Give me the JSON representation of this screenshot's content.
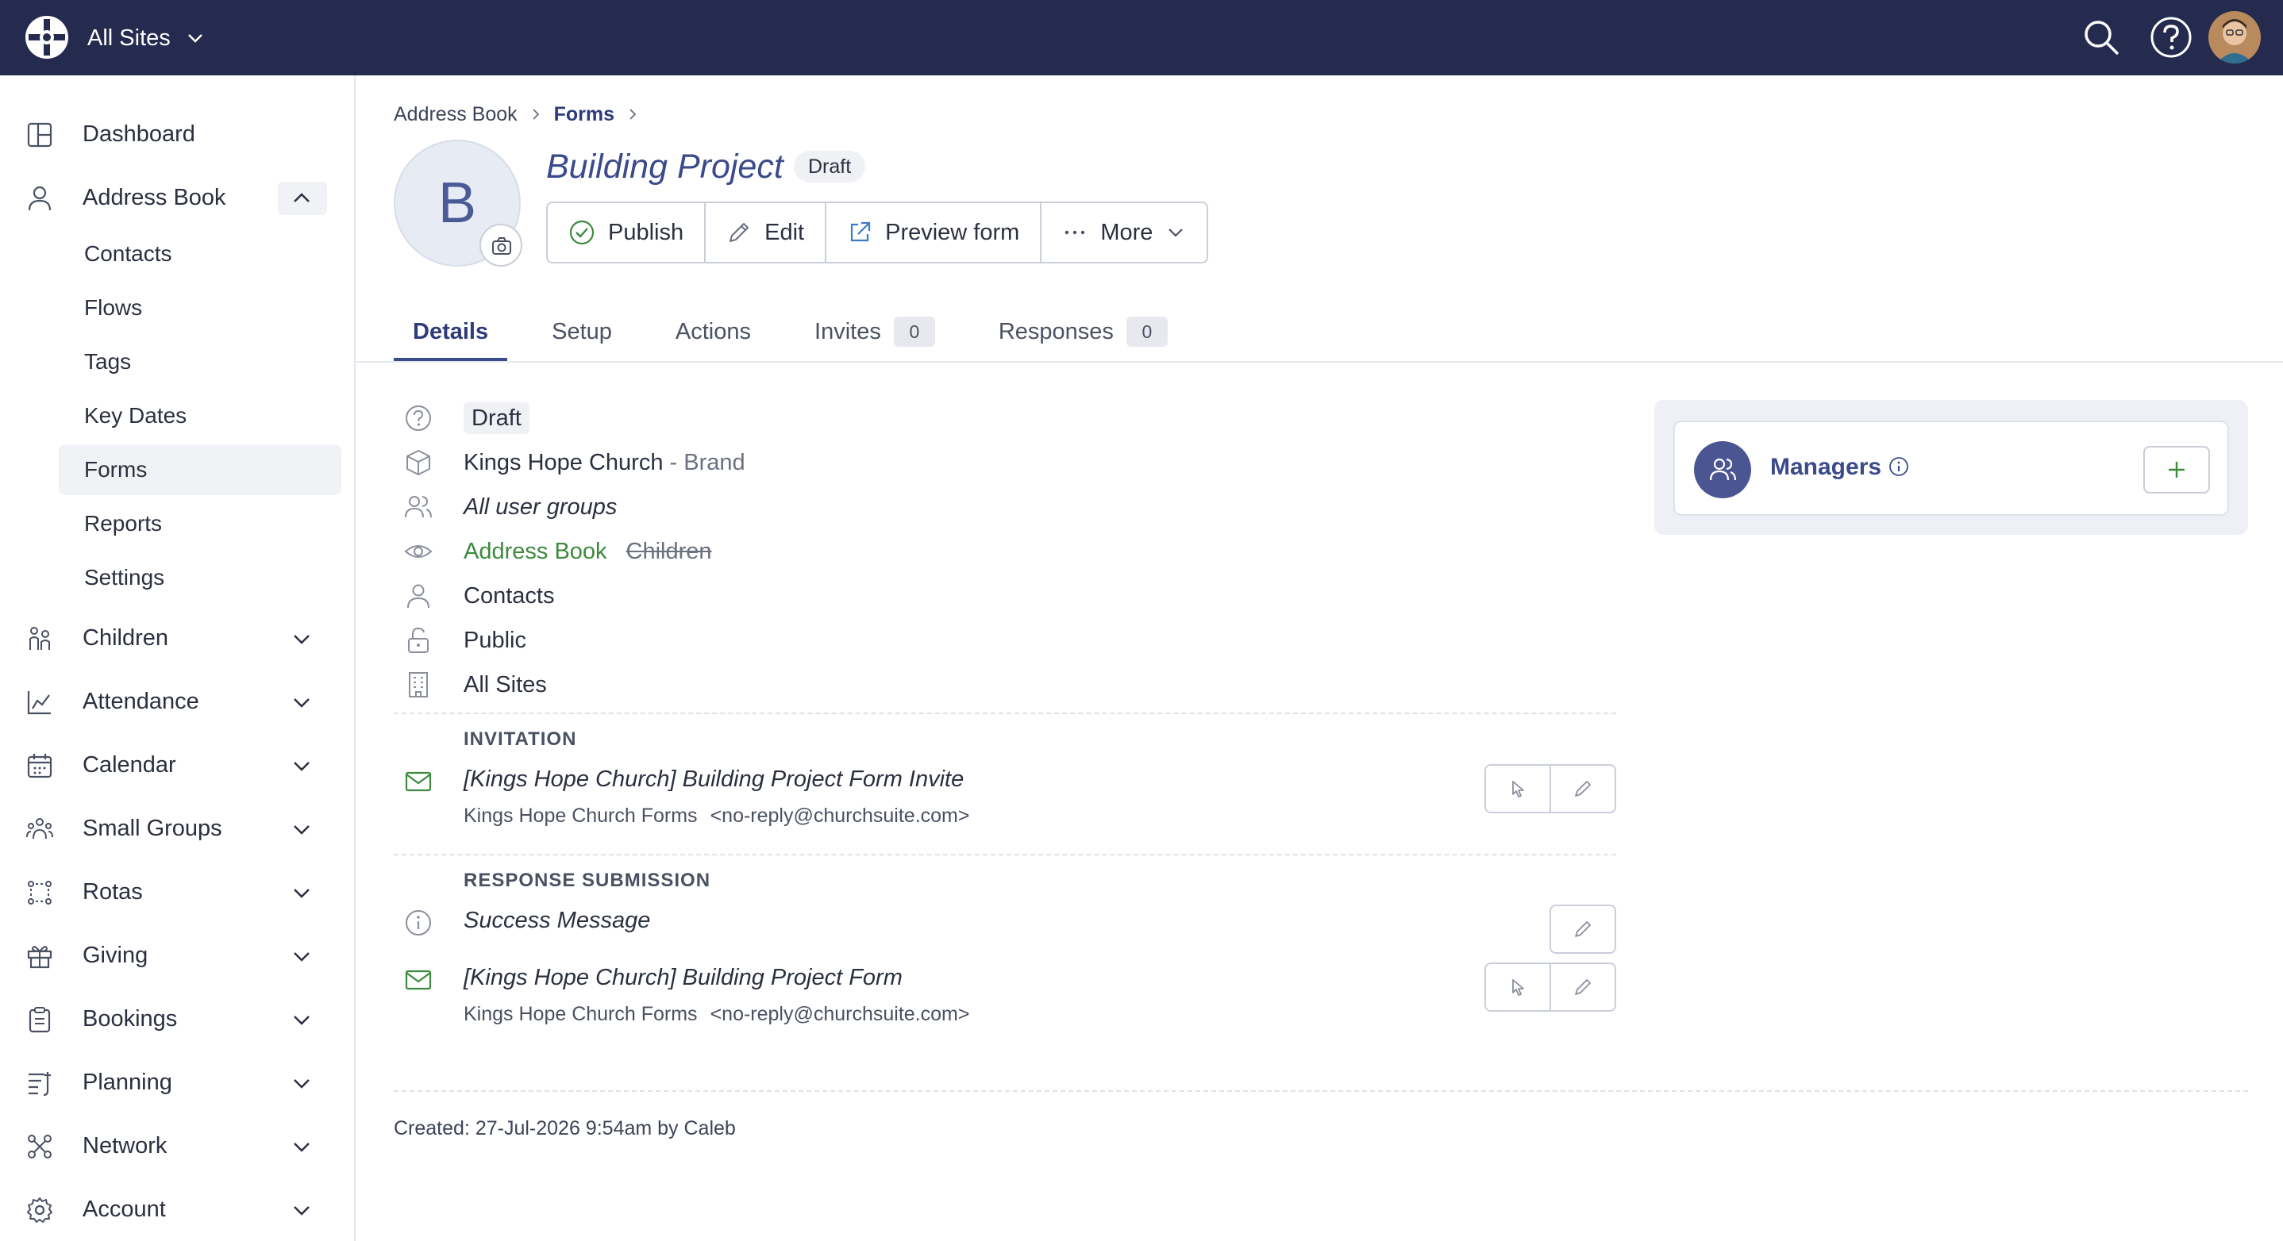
{
  "topbar": {
    "site_selector": "All Sites",
    "icons": [
      "search-icon",
      "help-icon",
      "user-avatar"
    ],
    "background": "#252b4f"
  },
  "sidebar": {
    "items": [
      {
        "label": "Dashboard",
        "icon": "dashboard-icon"
      },
      {
        "label": "Address Book",
        "icon": "person-icon",
        "expanded": true
      },
      {
        "label": "Children",
        "icon": "children-icon"
      },
      {
        "label": "Attendance",
        "icon": "attendance-chart-icon"
      },
      {
        "label": "Calendar",
        "icon": "calendar-icon"
      },
      {
        "label": "Small Groups",
        "icon": "small-groups-icon"
      },
      {
        "label": "Rotas",
        "icon": "rotas-icon"
      },
      {
        "label": "Giving",
        "icon": "gift-icon"
      },
      {
        "label": "Bookings",
        "icon": "bookings-clipboard-icon"
      },
      {
        "label": "Planning",
        "icon": "planning-icon"
      },
      {
        "label": "Network",
        "icon": "network-icon"
      },
      {
        "label": "Account",
        "icon": "gear-icon"
      }
    ],
    "address_book_sub": [
      "Contacts",
      "Flows",
      "Tags",
      "Key Dates",
      "Forms",
      "Reports",
      "Settings"
    ],
    "active_sub": "Forms"
  },
  "breadcrumb": [
    "Address Book",
    "Forms"
  ],
  "record": {
    "avatar_letter": "B",
    "title": "Building Project",
    "status": "Draft"
  },
  "actions": {
    "publish": "Publish",
    "edit": "Edit",
    "preview": "Preview form",
    "more": "More"
  },
  "tabs": [
    {
      "label": "Details",
      "active": true
    },
    {
      "label": "Setup"
    },
    {
      "label": "Actions"
    },
    {
      "label": "Invites",
      "count": "0"
    },
    {
      "label": "Responses",
      "count": "0"
    }
  ],
  "details": {
    "status": "Draft",
    "brand_name": "Kings Hope Church",
    "brand_suffix": "- Brand",
    "user_groups": "All user groups",
    "visibility_on": "Address Book",
    "visibility_off": "Children",
    "module": "Contacts",
    "access": "Public",
    "sites": "All Sites"
  },
  "invitation": {
    "heading": "INVITATION",
    "subject": "[Kings Hope Church] Building Project Form Invite",
    "from_name": "Kings Hope Church Forms",
    "from_email": "<no-reply@churchsuite.com>"
  },
  "response_submission": {
    "heading": "RESPONSE SUBMISSION",
    "success_message": "Success Message",
    "subject": "[Kings Hope Church] Building Project Form",
    "from_name": "Kings Hope Church Forms",
    "from_email": "<no-reply@churchsuite.com>"
  },
  "created": "Created: 27-Jul-2026 9:54am by Caleb",
  "managers": {
    "label": "Managers"
  },
  "colors": {
    "accent": "#3b4a8a",
    "green": "#3c8a3c",
    "muted": "#6b7080"
  }
}
